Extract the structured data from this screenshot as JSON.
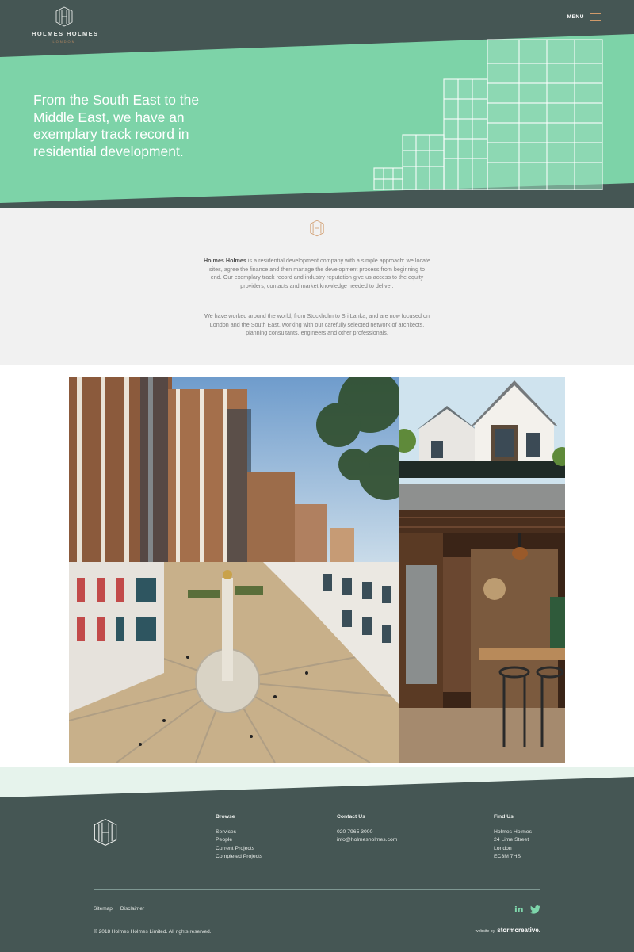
{
  "brand": {
    "name": "HOLMES HOLMES",
    "location": "LONDON"
  },
  "header": {
    "menu_label": "MENU"
  },
  "hero": {
    "headline": "From the South East to the Middle East, we have an exemplary track record in residential development."
  },
  "intro": {
    "paragraph1_bold": "Holmes Holmes",
    "paragraph1_rest": " is a residential development company with a simple approach: we locate sites, agree the finance and then manage the development process from beginning to end. Our exemplary track record and industry reputation give us access to the equity providers, contacts and market knowledge needed to deliver.",
    "paragraph2": "We have worked around the world, from Stockholm to Sri Lanka, and are now focused on London and the South East, working with our carefully selected network of architects, planning consultants, engineers and other professionals."
  },
  "gallery": {
    "images": [
      "apartment-towers-photo",
      "modern-houses-photo",
      "paternoster-square-photo",
      "kitchen-interior-photo"
    ]
  },
  "footer": {
    "browse_title": "Browse",
    "browse_links": [
      "Services",
      "People",
      "Current Projects",
      "Completed Projects"
    ],
    "contact_title": "Contact Us",
    "phone": "020 7965 3000",
    "email": "info@holmesholmes.com",
    "find_title": "Find Us",
    "address": [
      "Holmes Holmes",
      "24 Lime Street",
      "London",
      "EC3M 7HS"
    ],
    "bottom_links": [
      "Sitemap",
      "Disclaimer"
    ],
    "copyright": "© 2018 Holmes Holmes Limited. All rights reserved.",
    "credit_prefix": "website by",
    "credit_brand": "stormcreative."
  },
  "colors": {
    "dark": "#455654",
    "mint": "#7dd3a8",
    "accent": "#d09a6a",
    "light_bg": "#f1f1f1"
  }
}
